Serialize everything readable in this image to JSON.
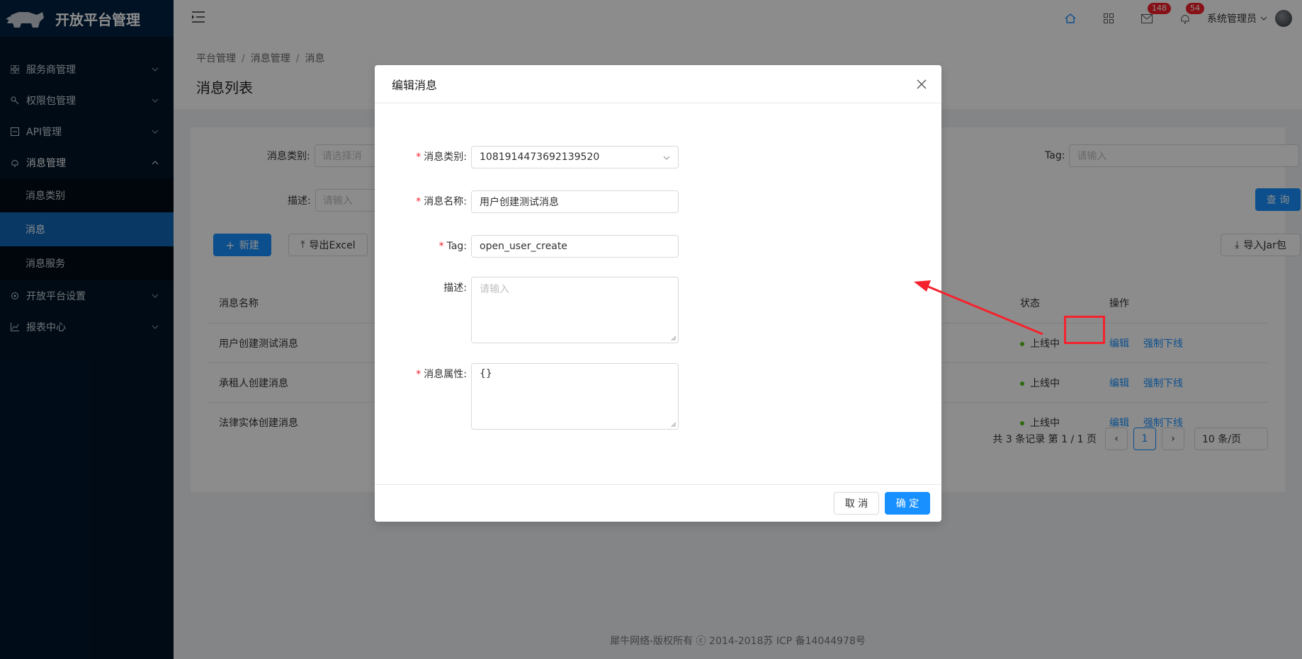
{
  "app": {
    "title": "开放平台管理"
  },
  "sidebar": {
    "items": [
      {
        "label": "服务商管理",
        "icon": "grid-icon"
      },
      {
        "label": "权限包管理",
        "icon": "key-icon"
      },
      {
        "label": "API管理",
        "icon": "api-icon"
      },
      {
        "label": "消息管理",
        "icon": "bell-icon"
      },
      {
        "label": "开放平台设置",
        "icon": "settings-icon"
      },
      {
        "label": "报表中心",
        "icon": "chart-icon"
      }
    ],
    "submenu": [
      {
        "label": "消息类别"
      },
      {
        "label": "消息"
      },
      {
        "label": "消息服务"
      }
    ]
  },
  "header": {
    "mail_count": "148",
    "notice_count": "54",
    "user_name": "系统管理员"
  },
  "page": {
    "breadcrumb": [
      "平台管理",
      "消息管理",
      "消息"
    ],
    "breadcrumb_sep": "/",
    "title": "消息列表",
    "filters": {
      "category_label": "消息类别:",
      "category_placeholder": "请选择消",
      "desc_label": "描述:",
      "desc_placeholder": "请输入",
      "tag_label": "Tag:",
      "tag_placeholder": "请输入"
    },
    "buttons": {
      "query": "查 询",
      "new": "新建",
      "export": "导出Excel",
      "import_jar": "导入Jar包"
    },
    "table": {
      "columns": {
        "name": "消息名称",
        "status": "状态",
        "action": "操作"
      },
      "rows": [
        {
          "name": "用户创建测试消息",
          "status": "上线中",
          "edit": "编辑",
          "offline": "强制下线"
        },
        {
          "name": "承租人创建消息",
          "status": "上线中",
          "edit": "编辑",
          "offline": "强制下线"
        },
        {
          "name": "法律实体创建消息",
          "status": "上线中",
          "edit": "编辑",
          "offline": "强制下线"
        }
      ]
    },
    "pagination": {
      "summary": "共 3 条记录 第 1 / 1 页",
      "current": "1",
      "page_size": "10 条/页"
    },
    "footer": "犀牛网络-版权所有 ⓒ 2014-2018苏 ICP 备14044978号"
  },
  "modal": {
    "title": "编辑消息",
    "fields": {
      "category": {
        "label": "消息类别:",
        "value": "1081914473692139520"
      },
      "name": {
        "label": "消息名称:",
        "value": "用户创建测试消息"
      },
      "tag": {
        "label": "Tag:",
        "value": "open_user_create"
      },
      "desc": {
        "label": "描述:",
        "placeholder": "请输入"
      },
      "attrs": {
        "label": "消息属性:",
        "value": "{}"
      }
    },
    "required_mark": "*",
    "cancel": "取 消",
    "ok": "确 定"
  },
  "colors": {
    "primary": "#1890ff",
    "sidebar": "#001529",
    "danger": "#f5222d"
  }
}
